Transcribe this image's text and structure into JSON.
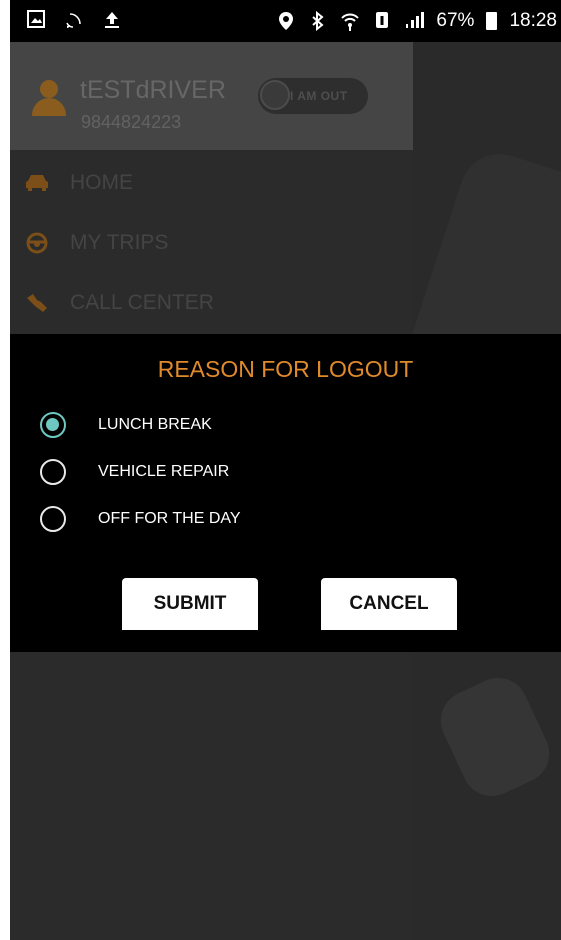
{
  "status_bar": {
    "icons_left": [
      "gallery-icon",
      "cast-icon",
      "upload-icon"
    ],
    "icons_right": [
      "location-icon",
      "bluetooth-icon",
      "wifi-icon",
      "sim-icon",
      "signal-icon"
    ],
    "battery": "67%",
    "time": "18:28"
  },
  "drawer": {
    "user_name": "tESTdRIVER",
    "phone": "9844824223",
    "toggle_label": "I AM OUT",
    "menu": [
      {
        "label": "HOME",
        "icon": "car-icon"
      },
      {
        "label": "MY TRIPS",
        "icon": "steering-wheel-icon"
      },
      {
        "label": "CALL CENTER",
        "icon": "phone-icon"
      }
    ]
  },
  "dialog": {
    "title": "REASON FOR LOGOUT",
    "options": [
      {
        "label": "LUNCH BREAK",
        "selected": true
      },
      {
        "label": "VEHICLE REPAIR",
        "selected": false
      },
      {
        "label": "OFF FOR THE DAY",
        "selected": false
      }
    ],
    "submit_label": "SUBMIT",
    "cancel_label": "CANCEL"
  },
  "colors": {
    "accent_orange": "#e08a2c",
    "radio_selected": "#6fc7c2",
    "dialog_bg": "#000000"
  }
}
